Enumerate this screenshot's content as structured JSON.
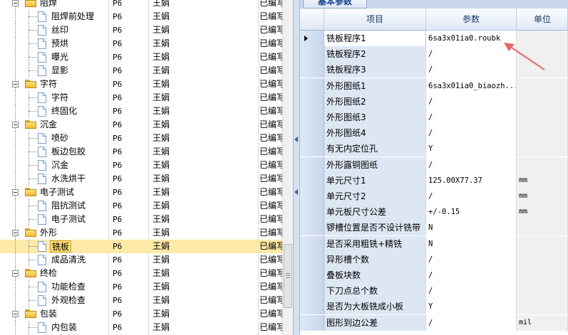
{
  "left_tree": {
    "rows": [
      {
        "name": "阻焊",
        "type": "group",
        "p": "P6",
        "user": "王娟",
        "status": "已编写"
      },
      {
        "name": "阻焊前处理",
        "type": "item",
        "p": "P6",
        "user": "王娟",
        "status": "已编写"
      },
      {
        "name": "丝印",
        "type": "item",
        "p": "P6",
        "user": "王娟",
        "status": "已编写"
      },
      {
        "name": "预烘",
        "type": "item",
        "p": "P6",
        "user": "王娟",
        "status": "已编写"
      },
      {
        "name": "曝光",
        "type": "item",
        "p": "P6",
        "user": "王娟",
        "status": "已编写"
      },
      {
        "name": "显影",
        "type": "item",
        "p": "P6",
        "user": "王娟",
        "status": "已编写"
      },
      {
        "name": "字符",
        "type": "group",
        "p": "P6",
        "user": "王娟",
        "status": "已编写"
      },
      {
        "name": "字符",
        "type": "item",
        "p": "P6",
        "user": "王娟",
        "status": "已编写"
      },
      {
        "name": "终固化",
        "type": "item",
        "p": "P6",
        "user": "王娟",
        "status": "已编写"
      },
      {
        "name": "沉金",
        "type": "group",
        "p": "P6",
        "user": "王娟",
        "status": "已编写"
      },
      {
        "name": "喷砂",
        "type": "item",
        "p": "P6",
        "user": "王娟",
        "status": "已编写"
      },
      {
        "name": "板边包胶",
        "type": "item",
        "p": "P6",
        "user": "王娟",
        "status": "已编写"
      },
      {
        "name": "沉金",
        "type": "item",
        "p": "P6",
        "user": "王娟",
        "status": "已编写"
      },
      {
        "name": "水洗烘干",
        "type": "item",
        "p": "P6",
        "user": "王娟",
        "status": "已编写"
      },
      {
        "name": "电子测试",
        "type": "group",
        "p": "P6",
        "user": "王娟",
        "status": "已编写"
      },
      {
        "name": "阻抗测试",
        "type": "item",
        "p": "P6",
        "user": "王娟",
        "status": "已编写"
      },
      {
        "name": "电子测试",
        "type": "item",
        "p": "P6",
        "user": "王娟",
        "status": "已编写"
      },
      {
        "name": "外形",
        "type": "group",
        "p": "P6",
        "user": "王娟",
        "status": "已编写"
      },
      {
        "name": "铣板",
        "type": "item",
        "p": "P6",
        "user": "王娟",
        "status": "已编写",
        "selected": true
      },
      {
        "name": "成品清洗",
        "type": "item",
        "p": "P6",
        "user": "王娟",
        "status": "已编写"
      },
      {
        "name": "终检",
        "type": "group",
        "p": "P6",
        "user": "王娟",
        "status": "已编写"
      },
      {
        "name": "功能检查",
        "type": "item",
        "p": "P6",
        "user": "王娟",
        "status": "已编写"
      },
      {
        "name": "外观检查",
        "type": "item",
        "p": "P6",
        "user": "王娟",
        "status": "已编写"
      },
      {
        "name": "包装",
        "type": "group",
        "p": "P6",
        "user": "王娟",
        "status": "已编写"
      },
      {
        "name": "内包装",
        "type": "item",
        "p": "P6",
        "user": "王娟",
        "status": "已编写"
      }
    ]
  },
  "right_panel": {
    "tab_label": "基本参数",
    "columns": {
      "item": "项目",
      "param": "参数",
      "unit": "单位"
    },
    "rows": [
      {
        "name": "铣板程序1",
        "value": "6sa3x01ia0.roubk",
        "unit": "",
        "current": true
      },
      {
        "name": "铣板程序2",
        "value": "/",
        "unit": ""
      },
      {
        "name": "铣板程序3",
        "value": "/",
        "unit": ""
      },
      {
        "name": "外形图纸1",
        "value": "6sa3x01ia0_biaozh...",
        "unit": ""
      },
      {
        "name": "外形图纸2",
        "value": "/",
        "unit": ""
      },
      {
        "name": "外形图纸3",
        "value": "/",
        "unit": ""
      },
      {
        "name": "外形图纸4",
        "value": "/",
        "unit": ""
      },
      {
        "name": "有无内定位孔",
        "value": "Y",
        "unit": ""
      },
      {
        "name": "外形露铜图纸",
        "value": "/",
        "unit": ""
      },
      {
        "name": "单元尺寸1",
        "value": "125.00X77.37",
        "unit": "mm"
      },
      {
        "name": "单元尺寸2",
        "value": "/",
        "unit": "mm"
      },
      {
        "name": "单元板尺寸公差",
        "value": "+/-0.15",
        "unit": "mm"
      },
      {
        "name": "锣槽位置是否不设计铣带",
        "value": "N",
        "unit": ""
      },
      {
        "name": "是否采用粗铣+精铣",
        "value": "N",
        "unit": ""
      },
      {
        "name": "异形槽个数",
        "value": "/",
        "unit": ""
      },
      {
        "name": "叠板块数",
        "value": "/",
        "unit": ""
      },
      {
        "name": "下刀点总个数",
        "value": "/",
        "unit": ""
      },
      {
        "name": "是否为大板铣成小板",
        "value": "Y",
        "unit": ""
      },
      {
        "name": "图形到边公差",
        "value": "/",
        "unit": "mil"
      }
    ]
  },
  "colors": {
    "selection": "#fde9a8",
    "name_column": "#dde7f4",
    "annotation_arrow": "#e06a6a"
  }
}
